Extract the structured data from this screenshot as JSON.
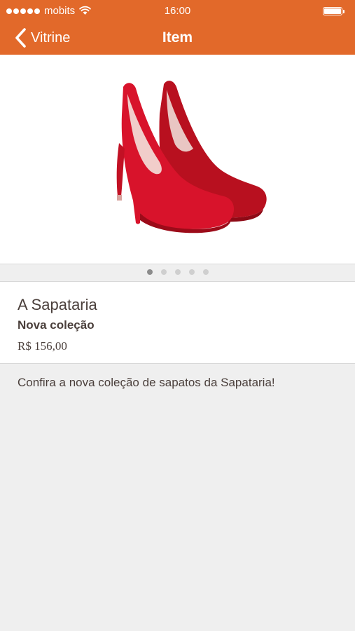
{
  "status_bar": {
    "carrier": "mobits",
    "time": "16:00",
    "signal_bars": 5
  },
  "nav": {
    "back_label": "Vitrine",
    "title": "Item"
  },
  "carousel": {
    "image": "red-high-heel-shoes",
    "page_count": 5,
    "current_page": 1
  },
  "item": {
    "store_name": "A Sapataria",
    "collection": "Nova coleção",
    "price": "R$ 156,00",
    "description": "Confira a nova coleção de sapatos da Sapataria!"
  },
  "colors": {
    "accent": "#e2692a",
    "background": "#efefef",
    "text": "#4a3f3b",
    "product_red": "#d8132b"
  }
}
